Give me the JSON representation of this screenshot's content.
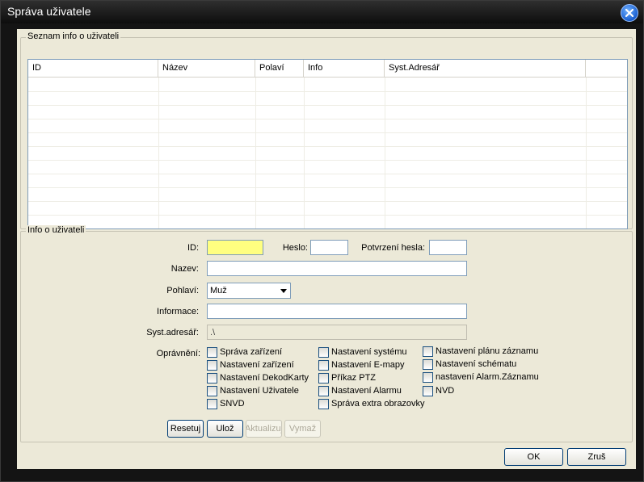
{
  "window": {
    "title": "Správa uživatele"
  },
  "icons": {
    "close": "close-icon",
    "dropdown": "chevron-down-icon"
  },
  "list_group": {
    "label": "Seznam info o uživateli",
    "columns": [
      "ID",
      "Název",
      "Polaví",
      "Info",
      "Syst.Adresář"
    ],
    "rows": []
  },
  "info_group": {
    "label": "Info o uživateli",
    "id_label": "ID:",
    "id_value": "",
    "password_label": "Heslo:",
    "password_value": "",
    "confirm_label": "Potvrzení hesla:",
    "confirm_value": "",
    "name_label": "Nazev:",
    "name_value": "",
    "gender_label": "Pohlaví:",
    "gender_value": "Muž",
    "information_label": "Informace:",
    "information_value": "",
    "sysdir_label": "Syst.adresář:",
    "sysdir_value": ".\\",
    "permissions_label": "Oprávnění:",
    "permissions": [
      [
        "Správa zařízení",
        "Nastavení zařízení",
        "Nastavení DekodKarty",
        "Nastavení Uživatele",
        "SNVD"
      ],
      [
        "Nastavení systému",
        "Nastavení E-mapy",
        "Příkaz PTZ",
        "Nastavení Alarmu",
        "Správa extra obrazovky"
      ],
      [
        "Nastavení plánu záznamu",
        "Nastavení schématu",
        "nastavení Alarm.Záznamu",
        "NVD"
      ]
    ],
    "buttons": {
      "reset": "Resetuj",
      "save": "Ulož",
      "update": "Aktualizuj",
      "delete": "Vymaž"
    }
  },
  "footer": {
    "ok": "OK",
    "cancel": "Zruš"
  }
}
